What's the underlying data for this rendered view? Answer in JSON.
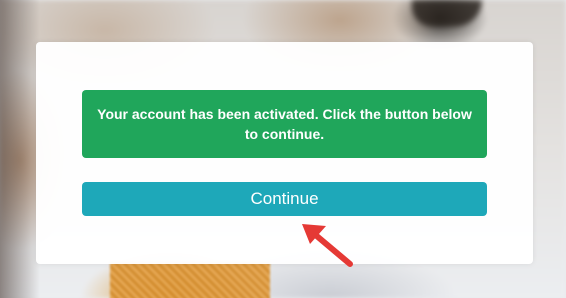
{
  "activation_message": {
    "text": "Your account has been activated. Click the button below to continue."
  },
  "continue_button": {
    "label": "Continue"
  },
  "annotation": {
    "icon": "red-arrow-icon"
  },
  "colors": {
    "success_bg": "#20a65b",
    "button_bg": "#1ea8b9",
    "arrow": "#e53935"
  }
}
